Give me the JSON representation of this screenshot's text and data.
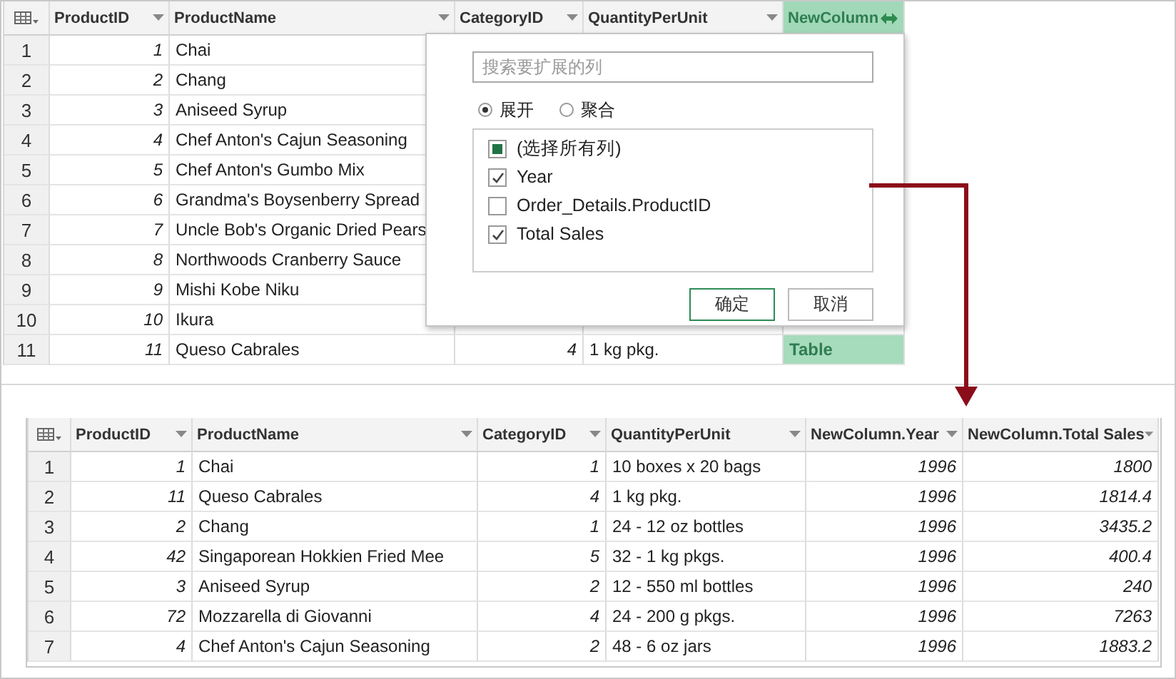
{
  "source_table": {
    "columns": [
      {
        "label": "ProductID",
        "kind": "number"
      },
      {
        "label": "ProductName",
        "kind": "text"
      },
      {
        "label": "CategoryID",
        "kind": "number"
      },
      {
        "label": "QuantityPerUnit",
        "kind": "text"
      },
      {
        "label": "NewColumn",
        "kind": "table"
      }
    ],
    "rows": [
      {
        "index": "1",
        "cells": [
          "1",
          "Chai",
          null,
          null,
          null
        ]
      },
      {
        "index": "2",
        "cells": [
          "2",
          "Chang",
          null,
          null,
          null
        ]
      },
      {
        "index": "3",
        "cells": [
          "3",
          "Aniseed Syrup",
          null,
          null,
          null
        ]
      },
      {
        "index": "4",
        "cells": [
          "4",
          "Chef Anton's Cajun Seasoning",
          null,
          null,
          null
        ]
      },
      {
        "index": "5",
        "cells": [
          "5",
          "Chef Anton's Gumbo Mix",
          null,
          null,
          null
        ]
      },
      {
        "index": "6",
        "cells": [
          "6",
          "Grandma's Boysenberry Spread",
          null,
          null,
          null
        ]
      },
      {
        "index": "7",
        "cells": [
          "7",
          "Uncle Bob's Organic Dried Pears",
          null,
          null,
          null
        ]
      },
      {
        "index": "8",
        "cells": [
          "8",
          "Northwoods Cranberry Sauce",
          null,
          null,
          null
        ]
      },
      {
        "index": "9",
        "cells": [
          "9",
          "Mishi Kobe Niku",
          null,
          null,
          null
        ]
      },
      {
        "index": "10",
        "cells": [
          "10",
          "Ikura",
          null,
          null,
          null
        ]
      },
      {
        "index": "11",
        "cells": [
          "11",
          "Queso Cabrales",
          "4",
          "1 kg pkg.",
          "Table"
        ]
      }
    ]
  },
  "expand_dialog": {
    "search": {
      "placeholder": "搜索要扩展的列"
    },
    "modes": [
      {
        "label": "展开",
        "selected": true
      },
      {
        "label": "聚合",
        "selected": false
      }
    ],
    "columns": [
      {
        "label": "(选择所有列)",
        "kind": "select-all",
        "checked": false
      },
      {
        "label": "Year",
        "kind": "column",
        "checked": true
      },
      {
        "label": "Order_Details.ProductID",
        "kind": "column",
        "checked": false
      },
      {
        "label": "Total Sales",
        "kind": "column",
        "checked": true
      }
    ],
    "buttons": [
      {
        "label": "确定",
        "default": true
      },
      {
        "label": "取消",
        "default": false
      }
    ]
  },
  "result_table": {
    "columns": [
      {
        "label": "ProductID",
        "kind": "number"
      },
      {
        "label": "ProductName",
        "kind": "text"
      },
      {
        "label": "CategoryID",
        "kind": "number"
      },
      {
        "label": "QuantityPerUnit",
        "kind": "text"
      },
      {
        "label": "NewColumn.Year",
        "kind": "number"
      },
      {
        "label": "NewColumn.Total Sales",
        "kind": "number"
      }
    ],
    "rows": [
      {
        "index": "1",
        "cells": [
          "1",
          "Chai",
          "1",
          "10 boxes x 20 bags",
          "1996",
          "1800"
        ]
      },
      {
        "index": "2",
        "cells": [
          "11",
          "Queso Cabrales",
          "4",
          "1 kg pkg.",
          "1996",
          "1814.4"
        ]
      },
      {
        "index": "3",
        "cells": [
          "2",
          "Chang",
          "1",
          "24 - 12 oz bottles",
          "1996",
          "3435.2"
        ]
      },
      {
        "index": "4",
        "cells": [
          "42",
          "Singaporean Hokkien Fried Mee",
          "5",
          "32 - 1 kg pkgs.",
          "1996",
          "400.4"
        ]
      },
      {
        "index": "5",
        "cells": [
          "3",
          "Aniseed Syrup",
          "2",
          "12 - 550 ml bottles",
          "1996",
          "240"
        ]
      },
      {
        "index": "6",
        "cells": [
          "72",
          "Mozzarella di Giovanni",
          "4",
          "24 - 200 g pkgs.",
          "1996",
          "7263"
        ]
      },
      {
        "index": "7",
        "cells": [
          "4",
          "Chef Anton's Cajun Seasoning",
          "2",
          "48 - 6 oz jars",
          "1996",
          "1883.2"
        ]
      }
    ]
  }
}
